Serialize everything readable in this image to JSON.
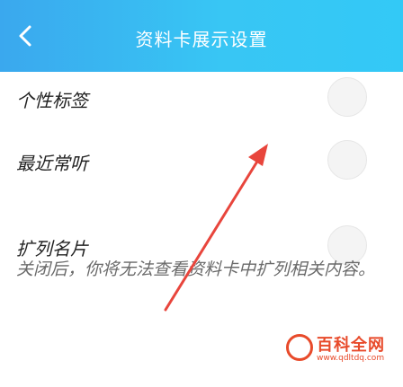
{
  "header": {
    "title": "资料卡展示设置",
    "back_icon": "chevron-left-icon"
  },
  "settings": [
    {
      "label": "个性标签",
      "enabled": false
    },
    {
      "label": "最近常听",
      "enabled": false
    },
    {
      "label": "扩列名片",
      "enabled": false
    }
  ],
  "note": "关闭后，你将无法查看资料卡中扩列相关内容。",
  "watermark": {
    "name": "百科全网",
    "url": "www.qdltdq.com"
  },
  "colors": {
    "header_start": "#3aa8ee",
    "header_end": "#33c9f6",
    "arrow": "#e8453c",
    "watermark": "#e84a2a"
  }
}
